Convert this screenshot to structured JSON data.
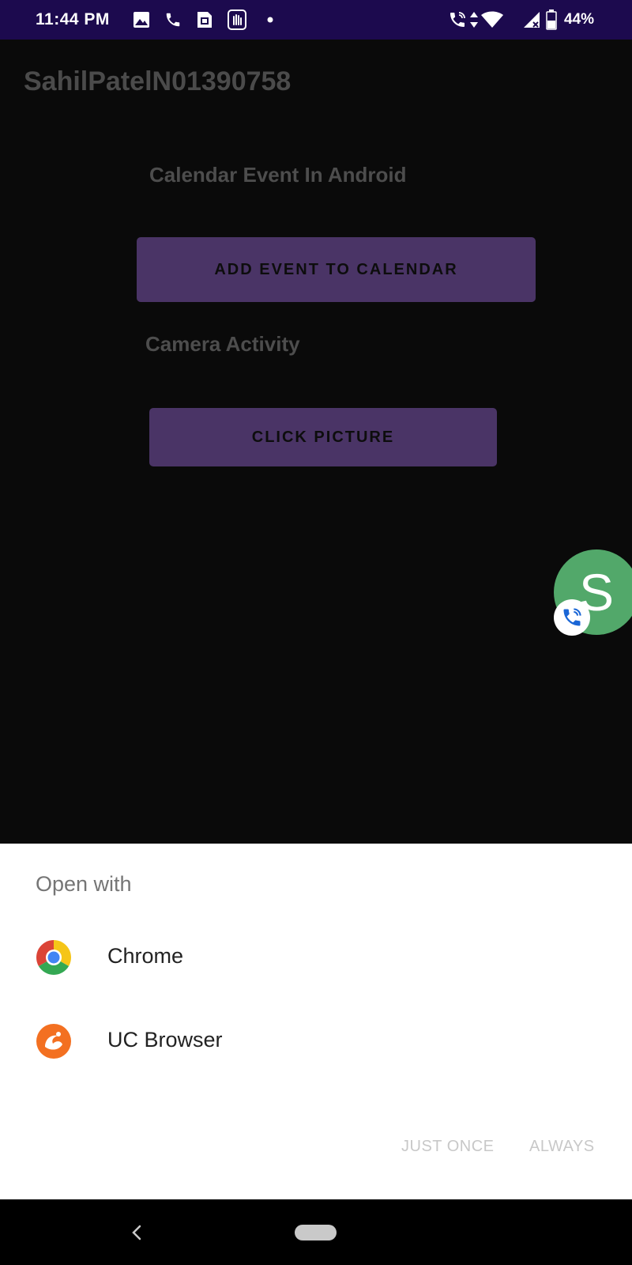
{
  "status_bar": {
    "time": "11:44 PM",
    "battery": "44%",
    "icons": [
      "image-icon",
      "phone-icon",
      "sim-toolkit-icon",
      "hand-icon",
      "dot-icon",
      "wifi-calling-icon",
      "data-arrows-icon",
      "wifi-icon",
      "signal-icon",
      "battery-icon"
    ]
  },
  "app": {
    "title": "SahilPatelN01390758",
    "calendar_label": "Calendar Event In Android",
    "add_event_button": "ADD EVENT TO CALENDAR",
    "camera_label": "Camera Activity",
    "click_picture_button": "CLICK PICTURE"
  },
  "chat_head": {
    "initial": "S",
    "badge_icon": "wifi-calling-icon",
    "color": "#52a86a"
  },
  "dialog": {
    "title": "Open with",
    "options": [
      {
        "label": "Chrome",
        "icon": "chrome-icon"
      },
      {
        "label": "UC Browser",
        "icon": "uc-browser-icon"
      }
    ],
    "just_once": "JUST ONCE",
    "always": "ALWAYS"
  },
  "colors": {
    "status_bar": "#1c0a4e",
    "button": "#4a3466",
    "background": "#0a0a0a"
  }
}
